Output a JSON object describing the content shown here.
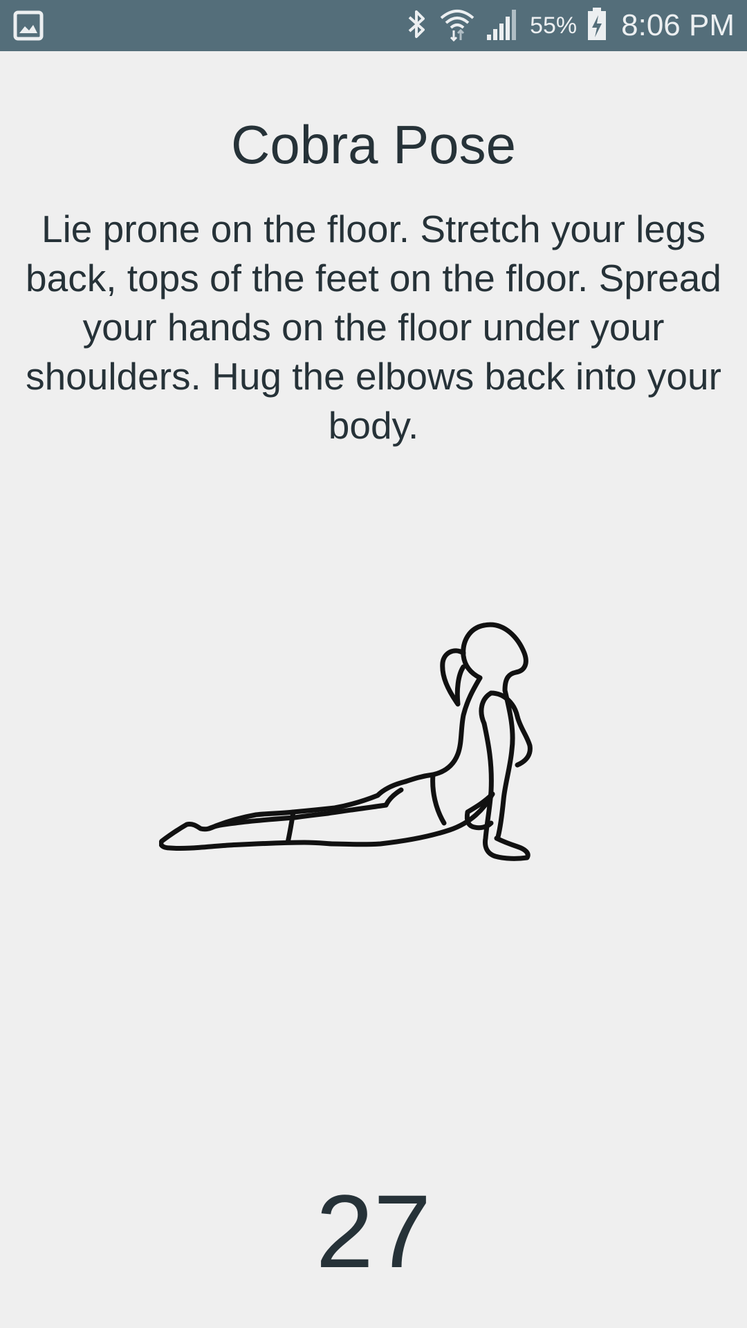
{
  "status_bar": {
    "notification_icon": "image-icon",
    "bluetooth_icon": "bluetooth-icon",
    "wifi_icon": "wifi-icon",
    "signal_icon": "signal-icon",
    "battery_percent": "55%",
    "battery_icon": "battery-charging-icon",
    "time": "8:06 PM",
    "bar_color": "#546e7a"
  },
  "exercise": {
    "title": "Cobra Pose",
    "description": "Lie prone on the floor. Stretch your legs back, tops of the feet on the floor. Spread your hands on the floor under your shoulders. Hug the elbows back into your body.",
    "illustration": "cobra-pose-figure",
    "countdown": "27"
  }
}
